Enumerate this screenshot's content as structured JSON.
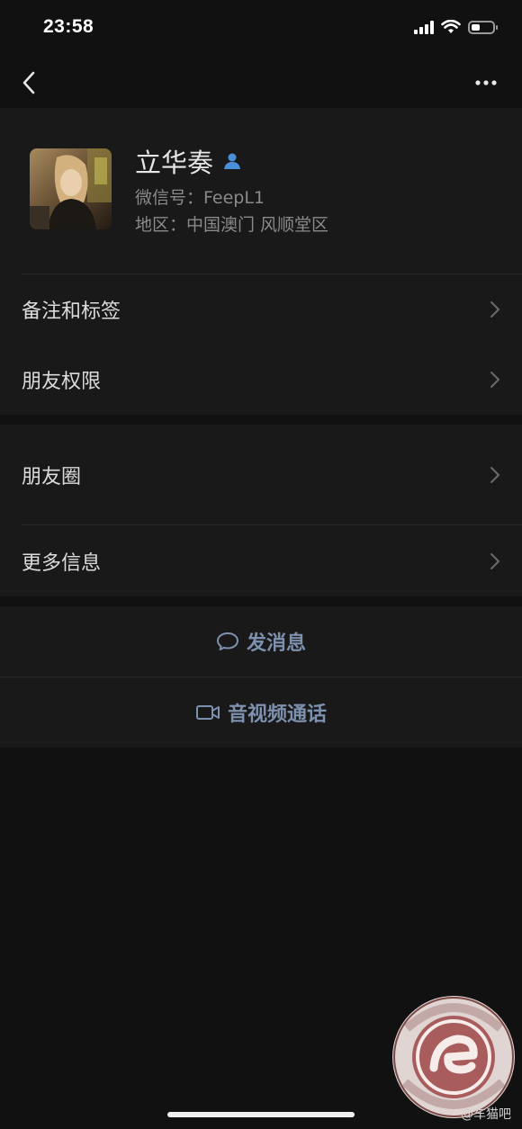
{
  "status_bar": {
    "time": "23:58",
    "battery_level": 0.4
  },
  "profile": {
    "name": "立华奏",
    "wechat_id": "微信号：FeepL1",
    "region": "地区：中国澳门 风顺堂区"
  },
  "menu_group_1": [
    {
      "label": "备注和标签"
    },
    {
      "label": "朋友权限"
    }
  ],
  "menu_group_2": [
    {
      "label": "朋友圈"
    },
    {
      "label": "更多信息"
    }
  ],
  "actions": {
    "send_message": "发消息",
    "video_call": "音视频通话"
  },
  "watermark": {
    "caption": "@车猫吧"
  },
  "colors": {
    "background": "#111111",
    "card": "#191919",
    "action_text": "#7d90ae",
    "badge_blue": "#4a90d9"
  }
}
